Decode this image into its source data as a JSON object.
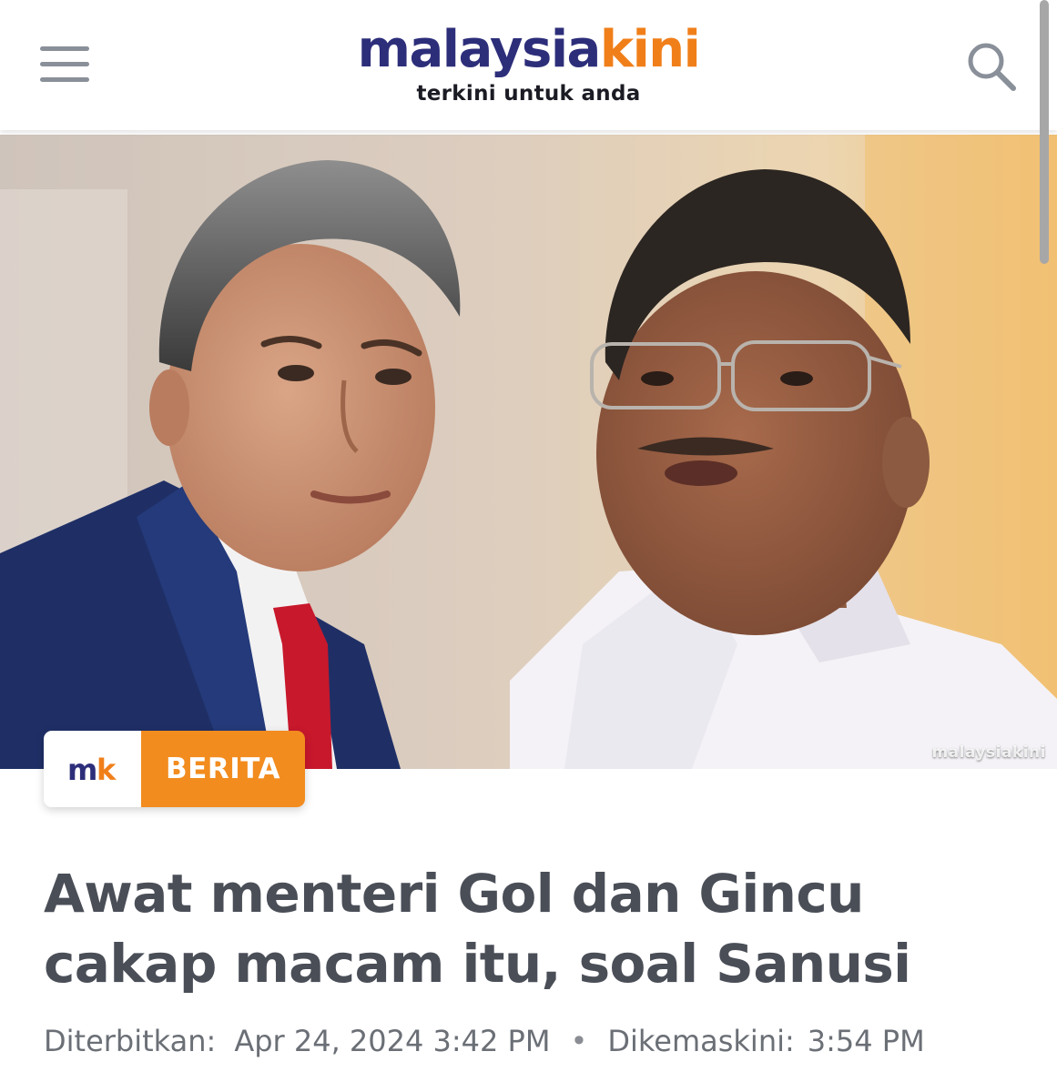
{
  "header": {
    "logo_part1": "malaysia",
    "logo_part2": "kini",
    "tagline": "terkini untuk anda",
    "menu_icon": "hamburger-menu-icon",
    "search_icon": "search-icon"
  },
  "hero": {
    "watermark": "malaysiakini"
  },
  "tag": {
    "logo_text": "mk",
    "label": "BERITA"
  },
  "article": {
    "title_line1": "Awat menteri Gol dan Gincu",
    "title_line2": "cakap macam itu, soal Sanusi",
    "published_label": "Diterbitkan:",
    "published_value": "Apr 24, 2024 3:42 PM",
    "separator": "•",
    "updated_label": "Dikemaskini:",
    "updated_value": "3:54 PM"
  },
  "colors": {
    "brand_navy": "#2d2e7a",
    "brand_orange": "#f07f1a",
    "headline": "#4a4e57",
    "meta": "#6b6f76"
  }
}
